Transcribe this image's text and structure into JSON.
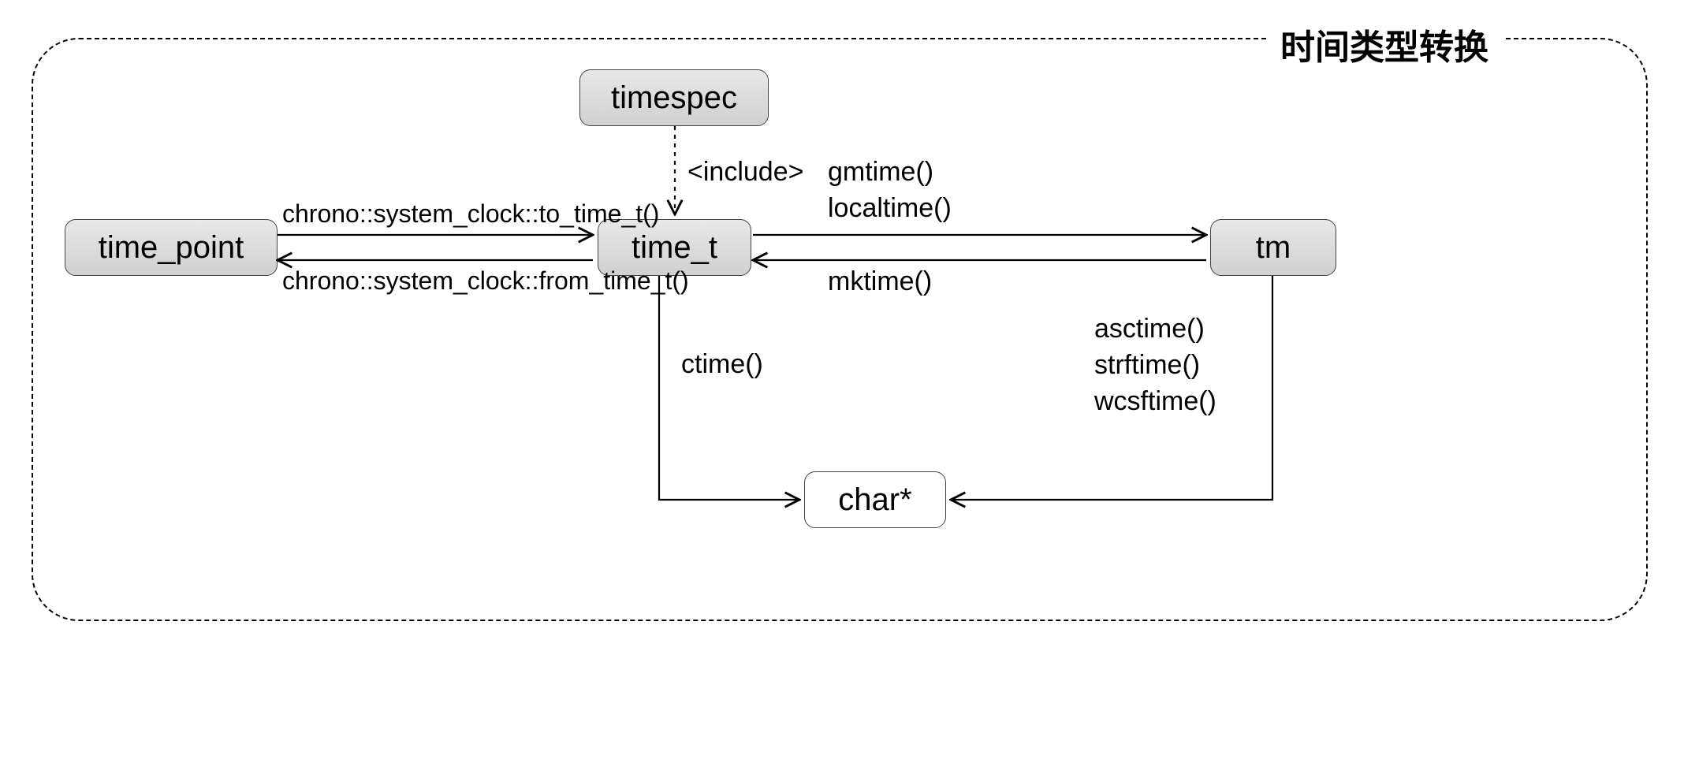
{
  "container_title": "时间类型转换",
  "nodes": {
    "timespec": "timespec",
    "time_point": "time_point",
    "time_t": "time_t",
    "tm": "tm",
    "charptr": "char*"
  },
  "edge_labels": {
    "include": "<include>",
    "to_time_t": "chrono::system_clock::to_time_t()",
    "from_time_t": "chrono::system_clock::from_time_t()",
    "gmtime": "gmtime()",
    "localtime": "localtime()",
    "mktime": "mktime()",
    "ctime": "ctime()",
    "asctime": "asctime()",
    "strftime": "strftime()",
    "wcsftime": "wcsftime()"
  }
}
